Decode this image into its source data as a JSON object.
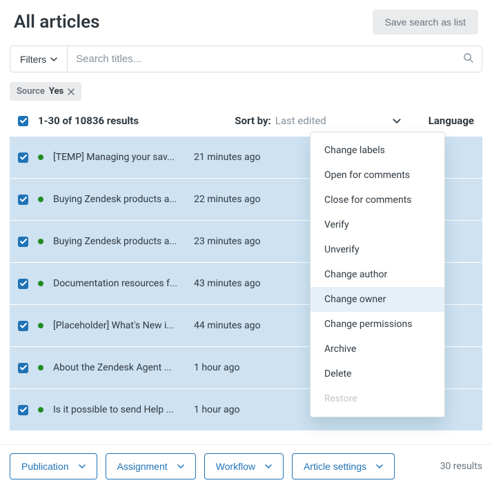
{
  "header": {
    "title": "All articles",
    "save_search_label": "Save search as list"
  },
  "toolbar": {
    "filters_label": "Filters",
    "search_placeholder": "Search titles..."
  },
  "chip": {
    "key": "Source",
    "value": "Yes"
  },
  "list_header": {
    "results_text": "1-30 of 10836 results",
    "sort_label": "Sort by:",
    "sort_value": "Last edited",
    "language_label": "Language"
  },
  "rows": [
    {
      "title": "[TEMP] Managing your sav...",
      "time": "21 minutes ago"
    },
    {
      "title": "Buying Zendesk products a...",
      "time": "22 minutes ago"
    },
    {
      "title": "Buying Zendesk products a...",
      "time": "23 minutes ago"
    },
    {
      "title": "Documentation resources f...",
      "time": "43 minutes ago"
    },
    {
      "title": "[Placeholder] What's New i...",
      "time": "44 minutes ago"
    },
    {
      "title": "About the Zendesk Agent ...",
      "time": "1 hour ago"
    },
    {
      "title": "Is it possible to send Help ...",
      "time": "1 hour ago"
    }
  ],
  "dropdown": {
    "items": [
      {
        "label": "Change labels"
      },
      {
        "label": "Open for comments"
      },
      {
        "label": "Close for comments"
      },
      {
        "label": "Verify"
      },
      {
        "label": "Unverify"
      },
      {
        "label": "Change author"
      },
      {
        "label": "Change owner",
        "highlight": true
      },
      {
        "label": "Change permissions"
      },
      {
        "label": "Archive"
      },
      {
        "label": "Delete"
      },
      {
        "label": "Restore",
        "disabled": true
      }
    ]
  },
  "footer": {
    "buttons": [
      {
        "label": "Publication"
      },
      {
        "label": "Assignment"
      },
      {
        "label": "Workflow"
      },
      {
        "label": "Article settings"
      }
    ],
    "count_text": "30 results"
  }
}
